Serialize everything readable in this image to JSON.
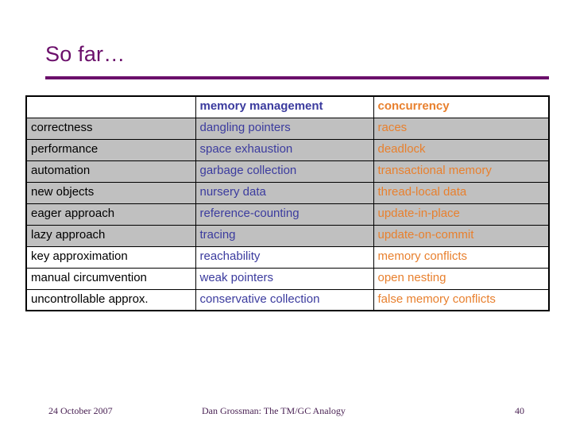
{
  "slide": {
    "title": "So far…",
    "accent_color": "#6B0F6B"
  },
  "table": {
    "columns": [
      {
        "key": "topic",
        "header": ""
      },
      {
        "key": "memory",
        "header": "memory management",
        "color": "#3B3B9E"
      },
      {
        "key": "concurrency",
        "header": "concurrency",
        "color": "#E8802E"
      }
    ],
    "shaded_color": "#C0C0C0",
    "rows": [
      {
        "topic": "correctness",
        "memory": "dangling pointers",
        "concurrency": "races"
      },
      {
        "topic": "performance",
        "memory": "space exhaustion",
        "concurrency": "deadlock"
      },
      {
        "topic": "automation",
        "memory": "garbage collection",
        "concurrency": "transactional memory"
      },
      {
        "topic": "new objects",
        "memory": "nursery data",
        "concurrency": "thread-local data"
      },
      {
        "topic": "eager approach",
        "memory": "reference-counting",
        "concurrency": "update-in-place"
      },
      {
        "topic": "lazy approach",
        "memory": "tracing",
        "concurrency": "update-on-commit"
      },
      {
        "topic": "key approximation",
        "memory": "reachability",
        "concurrency": "memory conflicts"
      },
      {
        "topic": "manual circumvention",
        "memory": "weak pointers",
        "concurrency": "open nesting"
      },
      {
        "topic": "uncontrollable approx.",
        "memory": "conservative collection",
        "concurrency": "false memory conflicts"
      }
    ]
  },
  "footer": {
    "date": "24 October 2007",
    "center": "Dan Grossman: The TM/GC Analogy",
    "page": "40"
  }
}
